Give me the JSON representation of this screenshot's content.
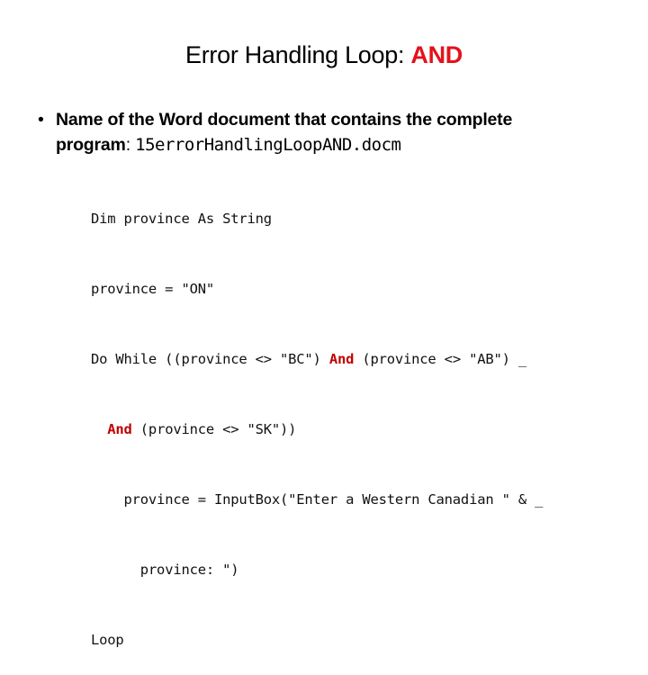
{
  "title": {
    "text": "Error Handling Loop: ",
    "accent": "AND",
    "accent_color": "#e3121b"
  },
  "bullet": {
    "icon": "bullet-dot",
    "glyph": "•",
    "line1": "Name of the Word document that contains the complete",
    "line2_label": "program",
    "line2_sep": ": ",
    "filename": "15errorHandlingLoopAND.docm"
  },
  "code": {
    "keyword_color": "#c00000",
    "lines": [
      {
        "indent": "",
        "pre": "Dim province As String",
        "kw": "",
        "post": ""
      },
      {
        "indent": "",
        "pre": "province = \"ON\"",
        "kw": "",
        "post": ""
      },
      {
        "indent": "",
        "pre": "Do While ((province <> \"BC\") ",
        "kw": "And",
        "post": " (province <> \"AB\") _"
      },
      {
        "indent": "  ",
        "pre": "",
        "kw": "And",
        "post": " (province <> \"SK\"))"
      },
      {
        "indent": "    ",
        "pre": "province = InputBox(\"Enter a Western Canadian \" & _",
        "kw": "",
        "post": ""
      },
      {
        "indent": "      ",
        "pre": "province: \")",
        "kw": "",
        "post": ""
      },
      {
        "indent": "",
        "pre": "Loop",
        "kw": "",
        "post": ""
      }
    ]
  }
}
